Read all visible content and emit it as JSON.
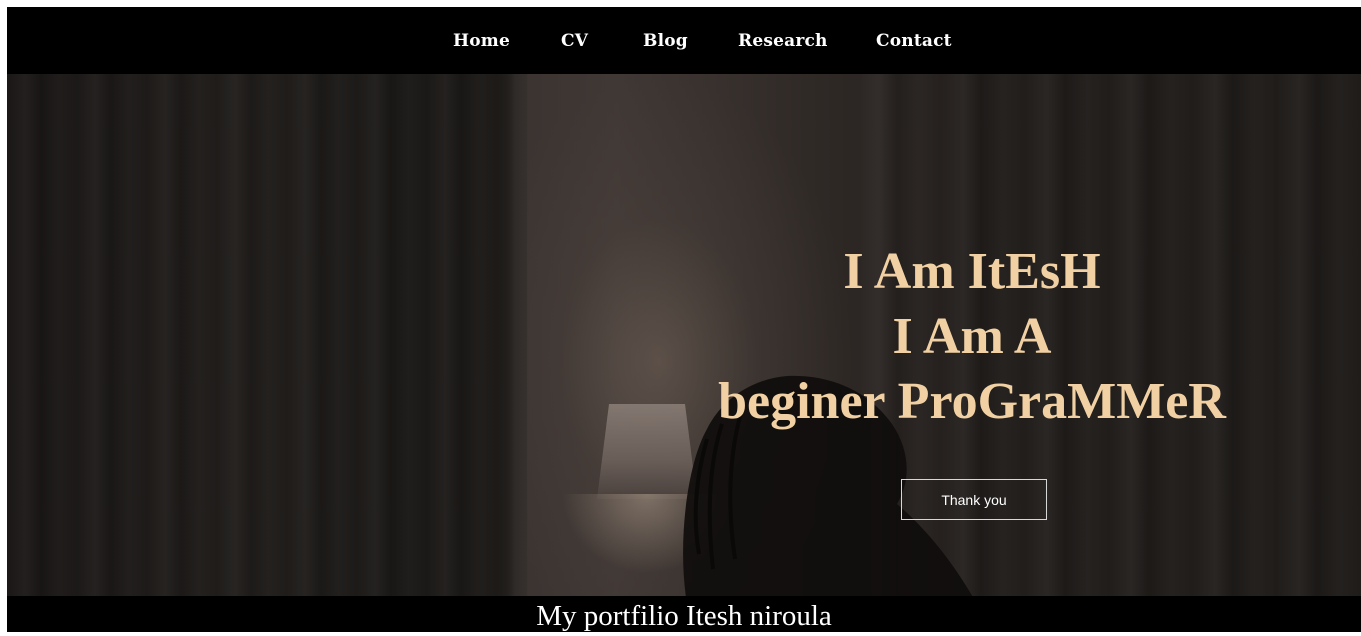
{
  "nav": {
    "items": [
      {
        "label": "Home"
      },
      {
        "label": "CV"
      },
      {
        "label": "Blog"
      },
      {
        "label": "Research"
      },
      {
        "label": "Contact"
      }
    ]
  },
  "hero": {
    "line1": "I Am ItEsH",
    "line2": "I Am A",
    "line3": "beginer ProGraMMeR",
    "button_label": "Thank you",
    "heading_color": "#f1d1a3"
  },
  "footer": {
    "text": "My portfilio Itesh niroula"
  }
}
